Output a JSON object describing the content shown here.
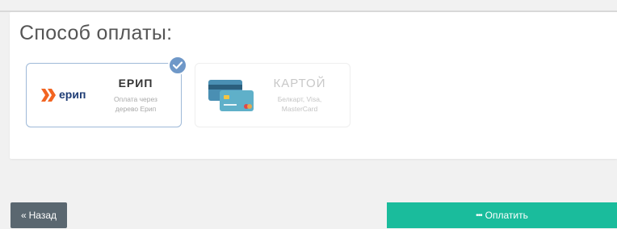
{
  "panel": {
    "title": "Способ оплаты:"
  },
  "payment_options": [
    {
      "id": "erip",
      "logo_text": "ерип",
      "title": "ЕРИП",
      "description": "Оплата через дерево Ерип",
      "selected": true,
      "icon": "erip-logo-icon"
    },
    {
      "id": "card",
      "title": "КАРТОЙ",
      "description": "Белкарт, Visa, MasterCard",
      "selected": false,
      "icon": "credit-card-icon"
    }
  ],
  "buttons": {
    "back_label": "Назад",
    "back_icon": "«",
    "pay_label": "Оплатить",
    "pay_icon": "•••"
  },
  "colors": {
    "accent_green": "#1abc9c",
    "back_button": "#5a6770",
    "selected_border": "#9eb9d8",
    "check_badge": "#6f98c8",
    "erip_orange": "#f26522",
    "erip_navy": "#1f3d75"
  }
}
